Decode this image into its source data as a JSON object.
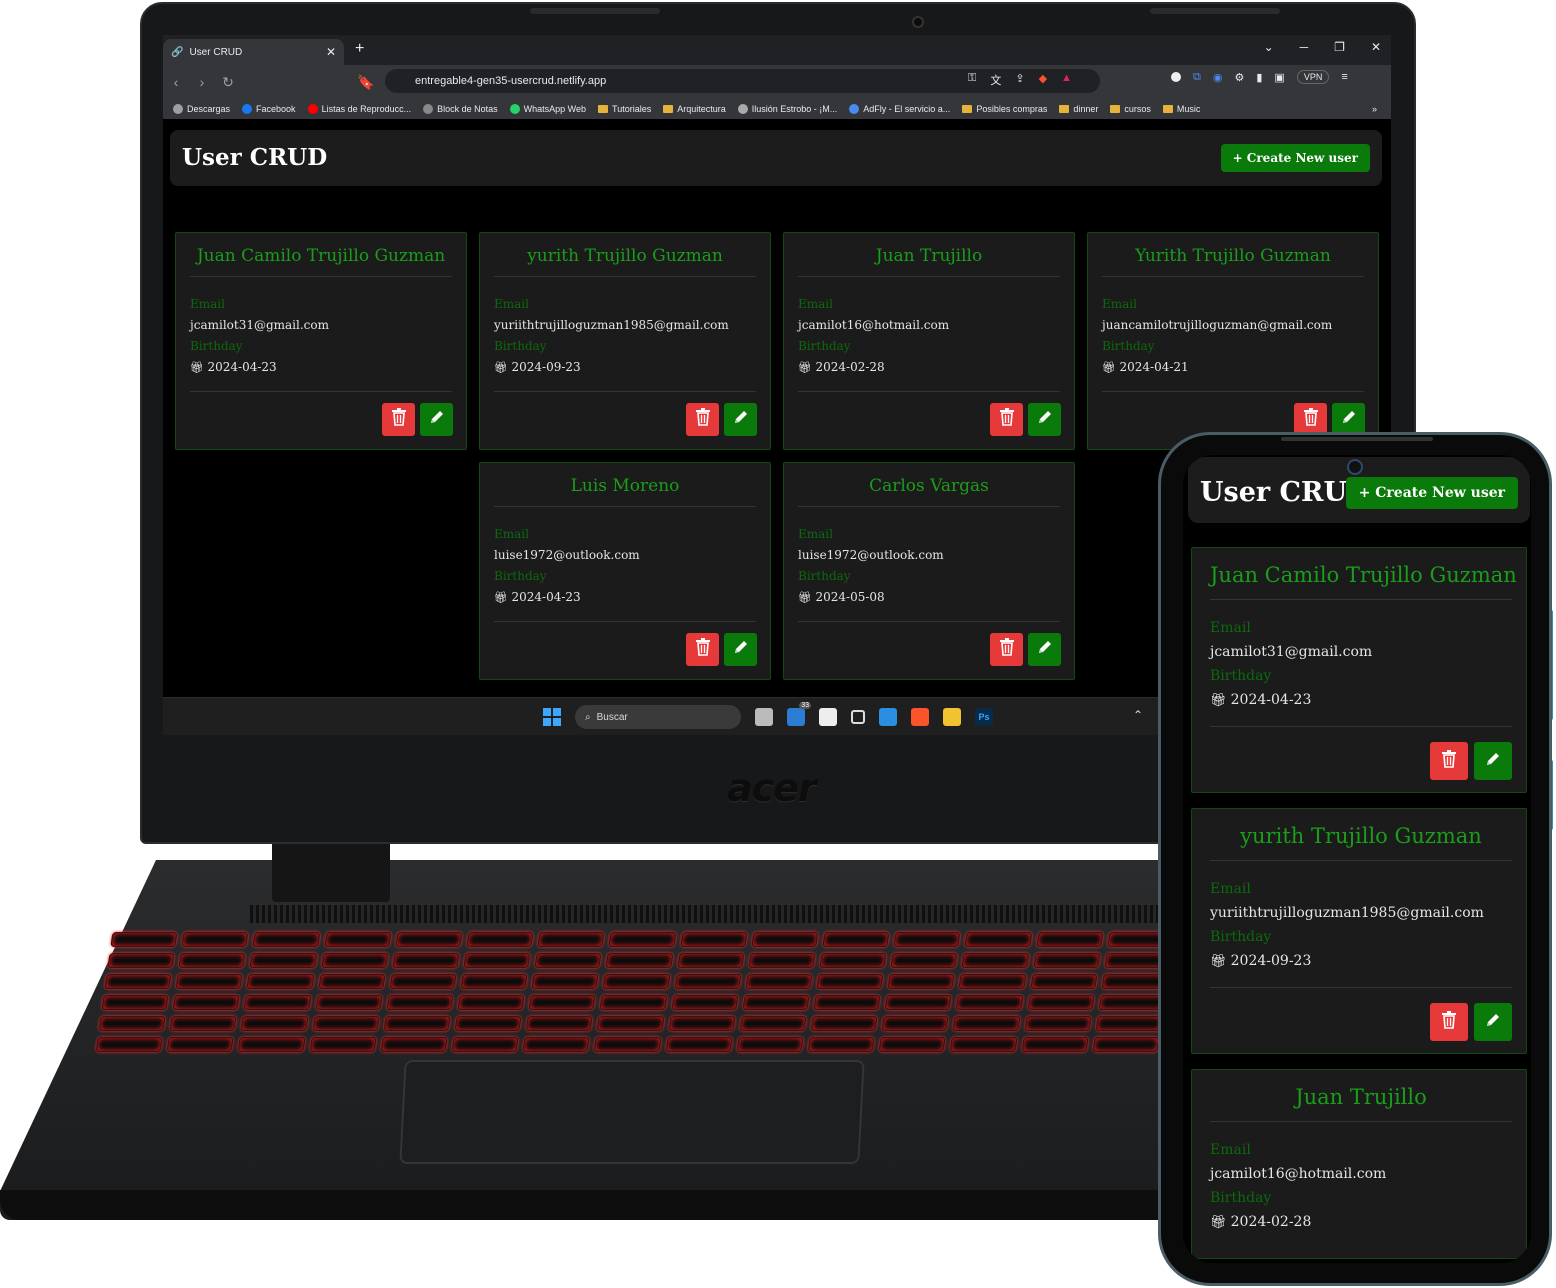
{
  "browser": {
    "tab_title": "User CRUD",
    "url": "entregable4-gen35-usercrud.netlify.app",
    "vpn_label": "VPN",
    "bookmarks": [
      "Descargas",
      "Facebook",
      "Listas de Reproducc...",
      "Block de Notas",
      "WhatsApp Web",
      "Tutoriales",
      "Arquitectura",
      "Ilusión Estrobo - ¡M...",
      "AdFly - El servicio a...",
      "Posibles compras",
      "dinner",
      "cursos",
      "Music"
    ]
  },
  "app": {
    "title": "User CRUD",
    "create_button": "+ Create New user",
    "email_label": "Email",
    "birthday_label": "Birthday",
    "users": [
      {
        "name": "Juan Camilo Trujillo Guzman",
        "email": "jcamilot31@gmail.com",
        "birthday": "2024-04-23"
      },
      {
        "name": "yurith Trujillo Guzman",
        "email": "yuriithtrujilloguzman1985@gmail.com",
        "birthday": "2024-09-23"
      },
      {
        "name": "Juan Trujillo",
        "email": "jcamilot16@hotmail.com",
        "birthday": "2024-02-28"
      },
      {
        "name": "Yurith Trujillo Guzman",
        "email": "juancamilotrujilloguzman@gmail.com",
        "birthday": "2024-04-21"
      },
      {
        "name": "Luis Moreno",
        "email": "luise1972@outlook.com",
        "birthday": "2024-04-23"
      },
      {
        "name": "Carlos Vargas",
        "email": "luise1972@outlook.com",
        "birthday": "2024-05-08"
      }
    ]
  },
  "taskbar": {
    "search_label": "Buscar",
    "badge": "33"
  },
  "laptop_brand": "acer",
  "colors": {
    "accent_green": "#0a7a0a",
    "name_green": "#1a9e1a",
    "delete_red": "#e63a3a",
    "card_bg": "#1b1b1b"
  }
}
